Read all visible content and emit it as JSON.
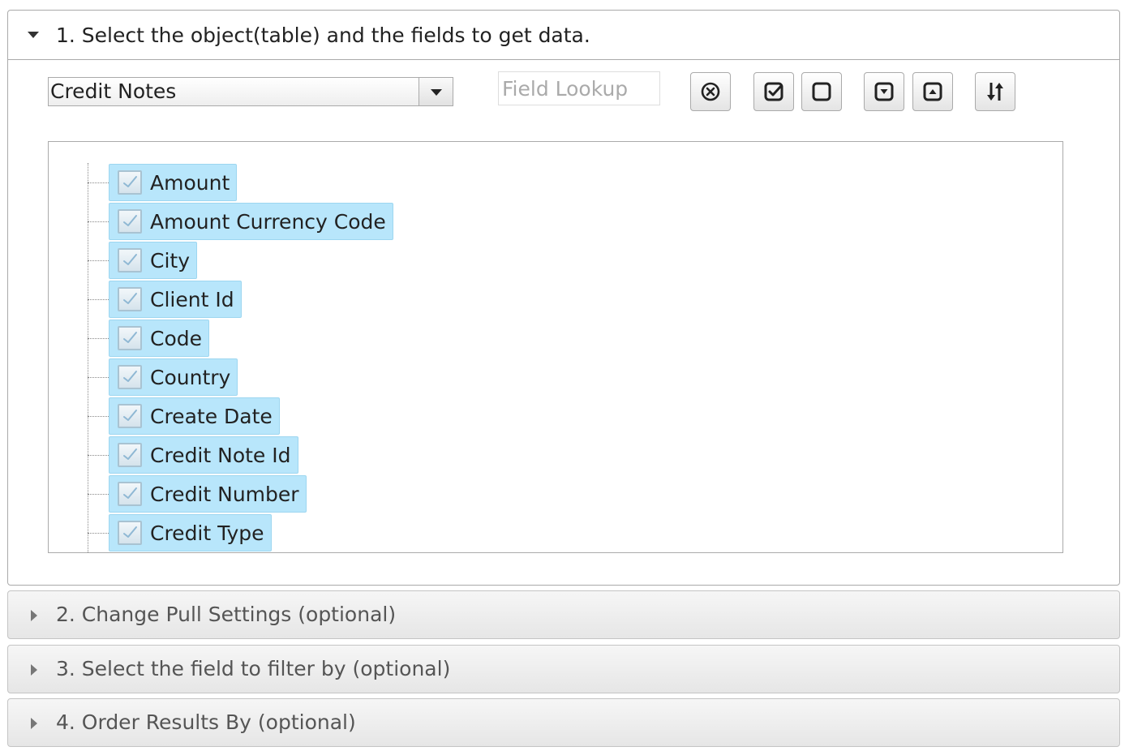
{
  "section1": {
    "title": "1. Select the object(table) and the fields to get data.",
    "object_select": {
      "value": "Credit Notes"
    },
    "field_lookup": {
      "value": "",
      "placeholder": "Field Lookup"
    },
    "toolbar": {
      "buttons": [
        {
          "name": "clear-lookup-button",
          "icon": "circle-x-icon"
        },
        {
          "name": "select-all-button",
          "icon": "checked-box-icon"
        },
        {
          "name": "deselect-all-button",
          "icon": "empty-box-icon"
        },
        {
          "name": "expand-all-button",
          "icon": "box-chevron-down-icon"
        },
        {
          "name": "collapse-all-button",
          "icon": "box-chevron-up-icon"
        },
        {
          "name": "sort-button",
          "icon": "sort-arrows-icon"
        }
      ]
    },
    "fields": [
      {
        "label": "Amount",
        "checked": true
      },
      {
        "label": "Amount Currency Code",
        "checked": true
      },
      {
        "label": "City",
        "checked": true
      },
      {
        "label": "Client Id",
        "checked": true
      },
      {
        "label": "Code",
        "checked": true
      },
      {
        "label": "Country",
        "checked": true
      },
      {
        "label": "Create Date",
        "checked": true
      },
      {
        "label": "Credit Note Id",
        "checked": true
      },
      {
        "label": "Credit Number",
        "checked": true
      },
      {
        "label": "Credit Type",
        "checked": true
      }
    ]
  },
  "section2": {
    "title": "2. Change Pull Settings (optional)"
  },
  "section3": {
    "title": "3. Select the field to filter by (optional)"
  },
  "section4": {
    "title": "4. Order Results By (optional)"
  },
  "colors": {
    "chip_bg": "#b8e6fb",
    "chip_border": "#9dd6f0",
    "border": "#aaaaaa"
  }
}
